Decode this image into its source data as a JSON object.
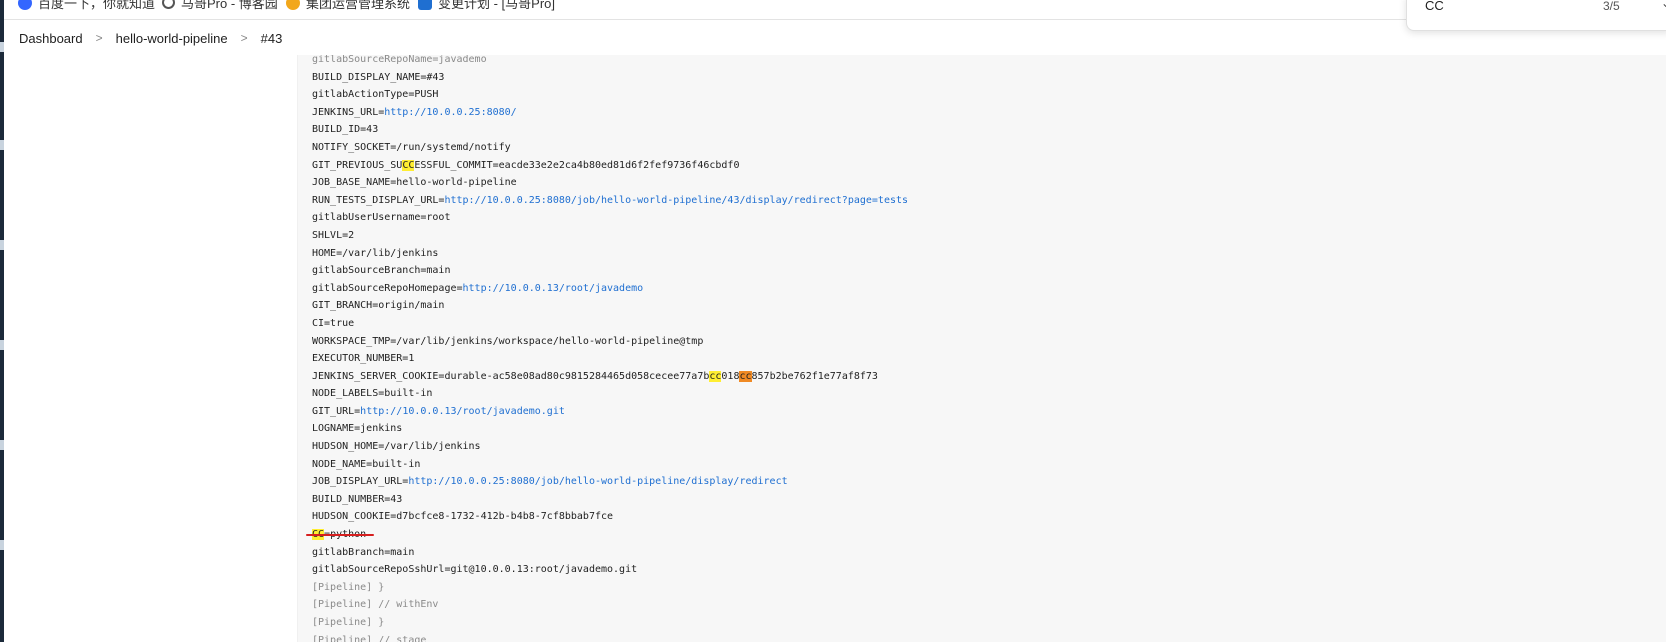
{
  "bookmarks": [
    {
      "label": "百度一下，你就知道",
      "icon": "baidu-icon",
      "color": "#3366ff"
    },
    {
      "label": "马哥Pro - 博客园",
      "icon": "search-icon",
      "color": "#555555"
    },
    {
      "label": "集团运营管理系统",
      "icon": "sun-icon",
      "color": "#f2a71b"
    },
    {
      "label": "变更计划 - [马哥Pro]",
      "icon": "app-icon",
      "color": "#1f6fd1"
    }
  ],
  "breadcrumb": {
    "items": [
      "Dashboard",
      "hello-world-pipeline",
      "#43"
    ],
    "separator": ">"
  },
  "find": {
    "query": "CC",
    "count": "3/5"
  },
  "colors": {
    "link": "#1f6fd1",
    "match": "#ffee32",
    "current_match": "#f08a24",
    "underline": "#d61f1f"
  },
  "console": {
    "lines": [
      {
        "parts": [
          {
            "text": "gitlabSourceRepoName=javademo"
          }
        ],
        "dim": true
      },
      {
        "parts": [
          {
            "text": "BUILD_DISPLAY_NAME=#43"
          }
        ]
      },
      {
        "parts": [
          {
            "text": "gitlabActionType=PUSH"
          }
        ]
      },
      {
        "parts": [
          {
            "text": "JENKINS_URL="
          },
          {
            "text": "http://10.0.0.25:8080/",
            "link": true
          }
        ]
      },
      {
        "parts": [
          {
            "text": "BUILD_ID=43"
          }
        ]
      },
      {
        "parts": [
          {
            "text": "NOTIFY_SOCKET=/run/systemd/notify"
          }
        ]
      },
      {
        "parts": [
          {
            "text": "GIT_PREVIOUS_SU"
          },
          {
            "text": "CC",
            "hl": "match"
          },
          {
            "text": "ESSFUL_COMMIT=eacde33e2e2ca4b80ed81d6f2fef9736f46cbdf0"
          }
        ]
      },
      {
        "parts": [
          {
            "text": "JOB_BASE_NAME=hello-world-pipeline"
          }
        ]
      },
      {
        "parts": [
          {
            "text": "RUN_TESTS_DISPLAY_URL="
          },
          {
            "text": "http://10.0.0.25:8080/job/hello-world-pipeline/43/display/redirect?page=tests",
            "link": true
          }
        ]
      },
      {
        "parts": [
          {
            "text": "gitlabUserUsername=root"
          }
        ]
      },
      {
        "parts": [
          {
            "text": "SHLVL=2"
          }
        ]
      },
      {
        "parts": [
          {
            "text": "HOME=/var/lib/jenkins"
          }
        ]
      },
      {
        "parts": [
          {
            "text": "gitlabSourceBranch=main"
          }
        ]
      },
      {
        "parts": [
          {
            "text": "gitlabSourceRepoHomepage="
          },
          {
            "text": "http://10.0.0.13/root/javademo",
            "link": true
          }
        ]
      },
      {
        "parts": [
          {
            "text": "GIT_BRANCH=origin/main"
          }
        ]
      },
      {
        "parts": [
          {
            "text": "CI=true"
          }
        ]
      },
      {
        "parts": [
          {
            "text": "WORKSPACE_TMP=/var/lib/jenkins/workspace/hello-world-pipeline@tmp"
          }
        ]
      },
      {
        "parts": [
          {
            "text": "EXECUTOR_NUMBER=1"
          }
        ]
      },
      {
        "parts": [
          {
            "text": "JENKINS_SERVER_COOKIE=durable-ac58e08ad80c9815284465d058cecee77a7b"
          },
          {
            "text": "cc",
            "hl": "match"
          },
          {
            "text": "018"
          },
          {
            "text": "cc",
            "hl": "current"
          },
          {
            "text": "857b2be762f1e77af8f73"
          }
        ]
      },
      {
        "parts": [
          {
            "text": "NODE_LABELS=built-in"
          }
        ]
      },
      {
        "parts": [
          {
            "text": "GIT_URL="
          },
          {
            "text": "http://10.0.0.13/root/javademo.git",
            "link": true
          }
        ]
      },
      {
        "parts": [
          {
            "text": "LOGNAME=jenkins"
          }
        ]
      },
      {
        "parts": [
          {
            "text": "HUDSON_HOME=/var/lib/jenkins"
          }
        ]
      },
      {
        "parts": [
          {
            "text": "NODE_NAME=built-in"
          }
        ]
      },
      {
        "parts": [
          {
            "text": "JOB_DISPLAY_URL="
          },
          {
            "text": "http://10.0.0.25:8080/job/hello-world-pipeline/display/redirect",
            "link": true
          }
        ]
      },
      {
        "parts": [
          {
            "text": "BUILD_NUMBER=43"
          }
        ]
      },
      {
        "parts": [
          {
            "text": "HUDSON_COOKIE=d7bcfce8-1732-412b-b4b8-7cf8bbab7fce"
          }
        ]
      },
      {
        "parts": [
          {
            "text": "CC",
            "hl": "match"
          },
          {
            "text": "=python"
          }
        ]
      },
      {
        "parts": [
          {
            "text": "gitlabBranch=main"
          }
        ]
      },
      {
        "parts": [
          {
            "text": "gitlabSourceRepoSshUrl=git@10.0.0.13:root/javademo.git"
          }
        ]
      },
      {
        "parts": [
          {
            "text": "[Pipeline] }"
          }
        ],
        "dim": true
      },
      {
        "parts": [
          {
            "text": "[Pipeline] // withEnv"
          }
        ],
        "dim": true
      },
      {
        "parts": [
          {
            "text": "[Pipeline] }"
          }
        ],
        "dim": true
      },
      {
        "parts": [
          {
            "text": "[Pipeline] // stage"
          }
        ],
        "dim": true
      }
    ]
  }
}
